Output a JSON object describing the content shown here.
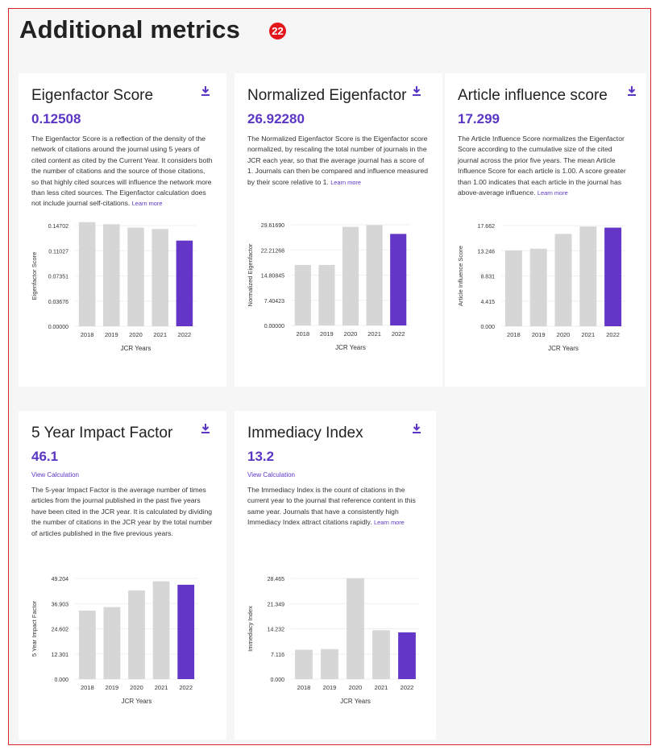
{
  "page": {
    "title": "Additional metrics",
    "badge": "22"
  },
  "cards": [
    {
      "title": "Eigenfactor Score",
      "value": "0.12508",
      "desc": "The Eigenfactor Score is a reflection of the density of the network of citations around the journal using 5 years of cited content as cited by the Current Year. It considers both the number of citations and the source of those citations, so that highly cited sources will influence the network more than less cited sources. The Eigenfactor calculation does not include journal self-citations.",
      "learn": "Learn more"
    },
    {
      "title": "Normalized Eigenfactor",
      "value": "26.92280",
      "desc": "The Normalized Eigenfactor Score is the Eigenfactor score normalized, by rescaling the total number of journals in the JCR each year, so that the average journal has a score of 1. Journals can then be compared and influence measured by their score relative to 1.",
      "learn": "Learn more"
    },
    {
      "title": "Article influence score",
      "value": "17.299",
      "desc": "The Article Influence Score normalizes the Eigenfactor Score according to the cumulative size of the cited journal across the prior five years. The mean Article Influence Score for each article is 1.00. A score greater than 1.00 indicates that each article in the journal has above-average influence.",
      "learn": "Learn more"
    },
    {
      "title": "5 Year Impact Factor",
      "value": "46.1",
      "view_calc": "View Calculation",
      "desc": "The 5-year Impact Factor is the average number of times articles from the journal published in the past five years have been cited in the JCR year. It is calculated by dividing the number of citations in the JCR year by the total number of articles published in the five previous years.",
      "learn": ""
    },
    {
      "title": "Immediacy Index",
      "value": "13.2",
      "view_calc": "View Calculation",
      "desc": "The Immediacy Index is the count of citations in the current year to the journal that reference content in this same year. Journals that have a consistently high Immediacy Index attract citations rapidly.",
      "learn": "Learn more"
    }
  ],
  "colors": {
    "accent": "#5b35c4",
    "bar_past": "#d6d6d6",
    "bar_current": "#6336c7"
  },
  "icons": [
    "download-icon"
  ],
  "chart_data": [
    {
      "type": "bar",
      "categories": [
        "2018",
        "2019",
        "2020",
        "2021",
        "2022"
      ],
      "values": [
        0.152,
        0.149,
        0.144,
        0.142,
        0.12508
      ],
      "yticks": [
        "0.00000",
        "0.03676",
        "0.07351",
        "0.11027",
        "0.14702"
      ],
      "ylim": [
        0,
        0.14702
      ],
      "xlabel": "JCR Years",
      "ylabel": "Eigenfactor Score",
      "highlight": "2022"
    },
    {
      "type": "bar",
      "categories": [
        "2018",
        "2019",
        "2020",
        "2021",
        "2022"
      ],
      "values": [
        17.8,
        17.8,
        29.0,
        29.5,
        26.9228
      ],
      "yticks": [
        "0.00000",
        "7.40423",
        "14.80845",
        "22.21268",
        "29.61690"
      ],
      "ylim": [
        0,
        29.6169
      ],
      "xlabel": "JCR Years",
      "ylabel": "Normalized Eigenfactor",
      "highlight": "2022"
    },
    {
      "type": "bar",
      "categories": [
        "2018",
        "2019",
        "2020",
        "2021",
        "2022"
      ],
      "values": [
        13.3,
        13.6,
        16.2,
        17.5,
        17.299
      ],
      "yticks": [
        "0.000",
        "4.415",
        "8.831",
        "13.246",
        "17.662"
      ],
      "ylim": [
        0,
        17.662
      ],
      "xlabel": "JCR Years",
      "ylabel": "Article Influence Score",
      "highlight": "2022"
    },
    {
      "type": "bar",
      "categories": [
        "2018",
        "2019",
        "2020",
        "2021",
        "2022"
      ],
      "values": [
        33.5,
        35.2,
        43.3,
        47.8,
        46.1
      ],
      "yticks": [
        "0.000",
        "12.301",
        "24.602",
        "36.903",
        "49.204"
      ],
      "ylim": [
        0,
        49.204
      ],
      "xlabel": "JCR Years",
      "ylabel": "5 Year Impact Factor",
      "highlight": "2022"
    },
    {
      "type": "bar",
      "categories": [
        "2018",
        "2019",
        "2020",
        "2021",
        "2022"
      ],
      "values": [
        8.3,
        8.5,
        28.5,
        13.8,
        13.2
      ],
      "yticks": [
        "0.000",
        "7.116",
        "14.232",
        "21.349",
        "28.465"
      ],
      "ylim": [
        0,
        28.465
      ],
      "xlabel": "JCR Years",
      "ylabel": "Immediacy Index",
      "highlight": "2022"
    }
  ]
}
